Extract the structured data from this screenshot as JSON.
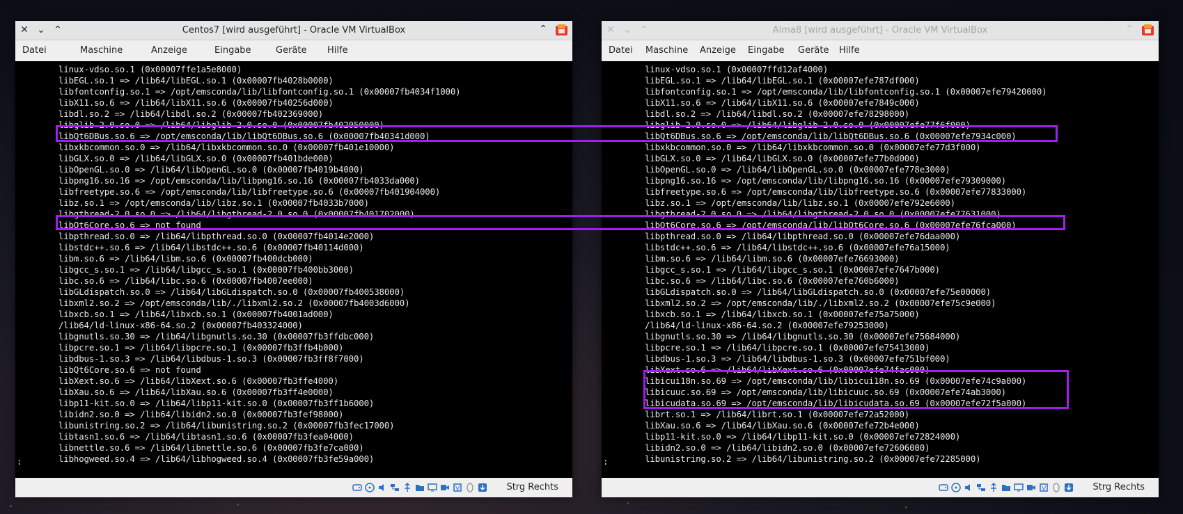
{
  "colors": {
    "highlight": "#a01ef0",
    "terminal_bg": "#000000",
    "terminal_fg": "#e8e8e8"
  },
  "left_window": {
    "title": "Centos7 [wird ausgeführt] - Oracle VM VirtualBox",
    "menu": [
      "Datei",
      "Maschine",
      "Anzeige",
      "Eingabe",
      "Geräte",
      "Hilfe"
    ],
    "host_key": "Strg Rechts",
    "prompt": ":",
    "lines": [
      "linux-vdso.so.1 (0x00007ffe1a5e8000)",
      "libEGL.so.1 => /lib64/libEGL.so.1 (0x00007fb4028b0000)",
      "libfontconfig.so.1 => /opt/emsconda/lib/libfontconfig.so.1 (0x00007fb4034f1000)",
      "libX11.so.6 => /lib64/libX11.so.6 (0x00007fb40256d000)",
      "libdl.so.2 => /lib64/libdl.so.2 (0x00007fb402369000)",
      "libglib-2.0.so.0 => /lib64/libglib-2.0.so.0 (0x00007fb402050000)",
      "libQt6DBus.so.6 => /opt/emsconda/lib/libQt6DBus.so.6 (0x00007fb40341d000)",
      "libxkbcommon.so.0 => /lib64/libxkbcommon.so.0 (0x00007fb401e10000)",
      "libGLX.so.0 => /lib64/libGLX.so.0 (0x00007fb401bde000)",
      "libOpenGL.so.0 => /lib64/libOpenGL.so.0 (0x00007fb4019b4000)",
      "libpng16.so.16 => /opt/emsconda/lib/libpng16.so.16 (0x00007fb4033da000)",
      "libfreetype.so.6 => /opt/emsconda/lib/libfreetype.so.6 (0x00007fb401904000)",
      "libz.so.1 => /opt/emsconda/lib/libz.so.1 (0x00007fb4033b7000)",
      "libgthread-2.0.so.0 => /lib64/libgthread-2.0.so.0 (0x00007fb401702000)",
      "libQt6Core.so.6 => not found",
      "libpthread.so.0 => /lib64/libpthread.so.0 (0x00007fb4014e2000)",
      "libstdc++.so.6 => /lib64/libstdc++.so.6 (0x00007fb40114d000)",
      "libm.so.6 => /lib64/libm.so.6 (0x00007fb400dcb000)",
      "libgcc_s.so.1 => /lib64/libgcc_s.so.1 (0x00007fb400bb3000)",
      "libc.so.6 => /lib64/libc.so.6 (0x00007fb4007ee000)",
      "libGLdispatch.so.0 => /lib64/libGLdispatch.so.0 (0x00007fb400538000)",
      "libxml2.so.2 => /opt/emsconda/lib/./libxml2.so.2 (0x00007fb4003d6000)",
      "libxcb.so.1 => /lib64/libxcb.so.1 (0x00007fb4001ad000)",
      "/lib64/ld-linux-x86-64.so.2 (0x00007fb403324000)",
      "libgnutls.so.30 => /lib64/libgnutls.so.30 (0x00007fb3ffdbc000)",
      "libpcre.so.1 => /lib64/libpcre.so.1 (0x00007fb3ffb4b000)",
      "libdbus-1.so.3 => /lib64/libdbus-1.so.3 (0x00007fb3ff8f7000)",
      "libQt6Core.so.6 => not found",
      "libXext.so.6 => /lib64/libXext.so.6 (0x00007fb3ffe4000)",
      "libXau.so.6 => /lib64/libXau.so.6 (0x00007fb3ff4e0000)",
      "libp11-kit.so.0 => /lib64/libp11-kit.so.0 (0x00007fb3ff1b6000)",
      "libidn2.so.0 => /lib64/libidn2.so.0 (0x00007fb3fef98000)",
      "libunistring.so.2 => /lib64/libunistring.so.2 (0x00007fb3fec17000)",
      "libtasn1.so.6 => /lib64/libtasn1.so.6 (0x00007fb3fea04000)",
      "libnettle.so.6 => /lib64/libnettle.so.6 (0x00007fb3fe7ca000)",
      "libhogweed.so.4 => /lib64/libhogweed.so.4 (0x00007fb3fe59a000)"
    ]
  },
  "right_window": {
    "title": "Alma8 [wird ausgeführt] - Oracle VM VirtualBox",
    "menu": [
      "Datei",
      "Maschine",
      "Anzeige",
      "Eingabe",
      "Geräte",
      "Hilfe"
    ],
    "host_key": "Strg Rechts",
    "prompt": ":",
    "lines": [
      "linux-vdso.so.1 (0x00007ffd12af4000)",
      "libEGL.so.1 => /lib64/libEGL.so.1 (0x00007efe787df000)",
      "libfontconfig.so.1 => /opt/emsconda/lib/libfontconfig.so.1 (0x00007efe79420000)",
      "libX11.so.6 => /lib64/libX11.so.6 (0x00007efe7849c000)",
      "libdl.so.2 => /lib64/libdl.so.2 (0x00007efe78298000)",
      "libglib-2.0.so.0 => /lib64/libglib-2.0.so.0 (0x00007efe77f6f000)",
      "libQt6DBus.so.6 => /opt/emsconda/lib/libQt6DBus.so.6 (0x00007efe7934c000)",
      "libxkbcommon.so.0 => /lib64/libxkbcommon.so.0 (0x00007efe77d3f000)",
      "libGLX.so.0 => /lib64/libGLX.so.0 (0x00007efe77b0d000)",
      "libOpenGL.so.0 => /lib64/libOpenGL.so.0 (0x00007efe778e3000)",
      "libpng16.so.16 => /opt/emsconda/lib/libpng16.so.16 (0x00007efe79309000)",
      "libfreetype.so.6 => /opt/emsconda/lib/libfreetype.so.6 (0x00007efe77833000)",
      "libz.so.1 => /opt/emsconda/lib/libz.so.1 (0x00007efe792e6000)",
      "libgthread-2.0.so.0 => /lib64/libgthread-2.0.so.0 (0x00007efe77631000)",
      "libQt6Core.so.6 => /opt/emsconda/lib/libQt6Core.so.6 (0x00007efe76fca000)",
      "libpthread.so.0 => /lib64/libpthread.so.0 (0x00007efe76daa000)",
      "libstdc++.so.6 => /lib64/libstdc++.so.6 (0x00007efe76a15000)",
      "libm.so.6 => /lib64/libm.so.6 (0x00007efe76693000)",
      "libgcc_s.so.1 => /lib64/libgcc_s.so.1 (0x00007efe7647b000)",
      "libc.so.6 => /lib64/libc.so.6 (0x00007efe760b6000)",
      "libGLdispatch.so.0 => /lib64/libGLdispatch.so.0 (0x00007efe75e00000)",
      "libxml2.so.2 => /opt/emsconda/lib/./libxml2.so.2 (0x00007efe75c9e000)",
      "libxcb.so.1 => /lib64/libxcb.so.1 (0x00007efe75a75000)",
      "/lib64/ld-linux-x86-64.so.2 (0x00007efe79253000)",
      "libgnutls.so.30 => /lib64/libgnutls.so.30 (0x00007efe75684000)",
      "libpcre.so.1 => /lib64/libpcre.so.1 (0x00007efe75413000)",
      "libdbus-1.so.3 => /lib64/libdbus-1.so.3 (0x00007efe751bf000)",
      "libXext.so.6 => /lib64/libXext.so.6 (0x00007efe74fac000)",
      "libicui18n.so.69 => /opt/emsconda/lib/libicui18n.so.69 (0x00007efe74c9a000)",
      "libicuuc.so.69 => /opt/emsconda/lib/libicuuc.so.69 (0x00007efe74ab3000)",
      "libicudata.so.69 => /opt/emsconda/lib/libicudata.so.69 (0x00007efe72f5a000)",
      "librt.so.1 => /lib64/librt.so.1 (0x00007efe72a52000)",
      "libXau.so.6 => /lib64/libXau.so.6 (0x00007efe72b4e000)",
      "libp11-kit.so.0 => /lib64/libp11-kit.so.0 (0x00007efe72824000)",
      "libidn2.so.0 => /lib64/libidn2.so.0 (0x00007efe72606000)",
      "libunistring.so.2 => /lib64/libunistring.so.2 (0x00007efe72285000)"
    ]
  },
  "status_icons": [
    "hard-disk-icon",
    "optical-disk-icon",
    "audio-icon",
    "network-icon",
    "usb-icon",
    "shared-folder-icon",
    "display-icon",
    "video-capture-icon",
    "virtualization-engine-icon",
    "mouse-integration-icon",
    "host-key-arrow-icon"
  ]
}
